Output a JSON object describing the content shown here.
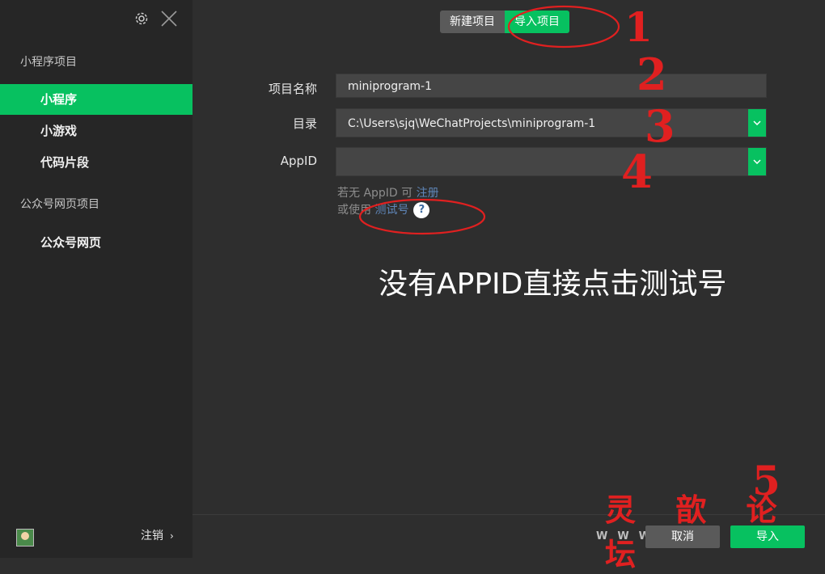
{
  "sidebar": {
    "section_miniprogram": "小程序项目",
    "items": [
      {
        "label": "小程序"
      },
      {
        "label": "小游戏"
      },
      {
        "label": "代码片段"
      }
    ],
    "section_official": "公众号网页项目",
    "official_item": "公众号网页",
    "logout": "注销"
  },
  "tabs": {
    "new": "新建项目",
    "import": "导入项目"
  },
  "form": {
    "name_label": "项目名称",
    "name_value": "miniprogram-1",
    "dir_label": "目录",
    "dir_value": "C:\\Users\\sjq\\WeChatProjects\\miniprogram-1",
    "appid_label": "AppID",
    "appid_value": "",
    "hint1_prefix": "若无 AppID 可",
    "hint1_link": "注册",
    "hint2_prefix": "或使用",
    "hint2_link": "测试号",
    "help": "?"
  },
  "note": "没有APPID直接点击测试号",
  "annotations": {
    "n1": "1",
    "n2": "2",
    "n3": "3",
    "n4": "4",
    "n5": "5",
    "watermark_cn": "灵 歆 论 坛",
    "watermark_w": "WWW"
  },
  "footer": {
    "cancel": "取消",
    "import": "导入"
  },
  "colors": {
    "accent": "#07c160",
    "annotation": "#e02020"
  }
}
